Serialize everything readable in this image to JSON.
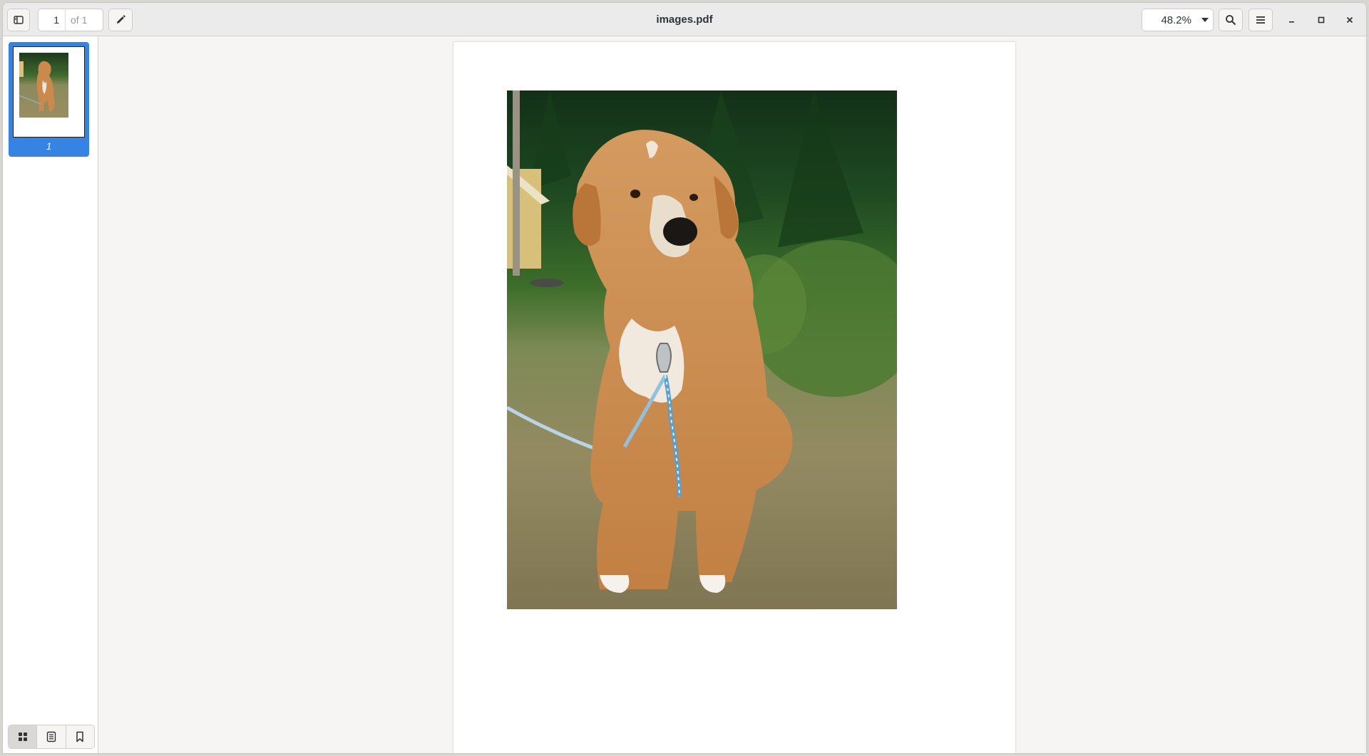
{
  "window": {
    "title": "images.pdf"
  },
  "toolbar": {
    "current_page": "1",
    "total_pages": "of 1",
    "zoom": "48.2%"
  },
  "sidebar": {
    "thumbnails": [
      {
        "label": "1",
        "selected": true
      }
    ],
    "switcher": [
      "thumbnails-icon",
      "outline-icon",
      "bookmarks-icon"
    ]
  },
  "colors": {
    "accent": "#3584e4",
    "headerbar": "#ebebeb",
    "background": "#f6f5f4"
  }
}
